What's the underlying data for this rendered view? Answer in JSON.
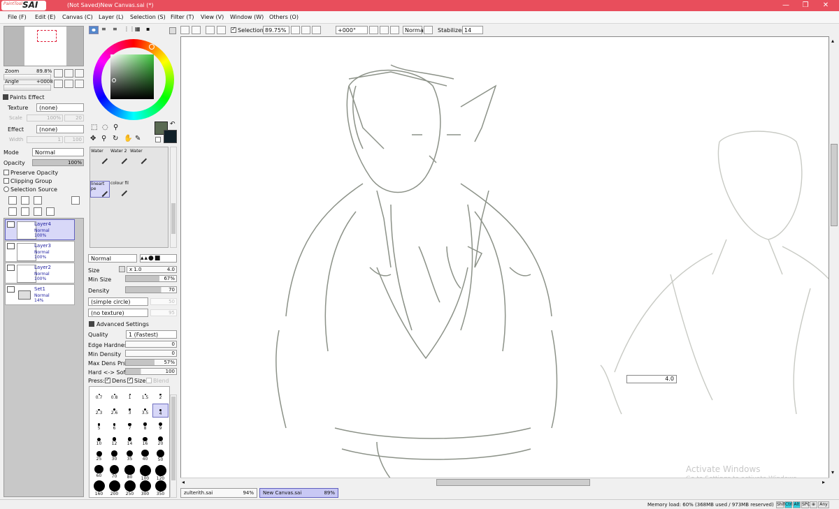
{
  "window": {
    "app_logo_small": "PaintTool",
    "app_logo_big": "SAI",
    "title": "(Not Saved)New Canvas.sai (*)",
    "minimize": "—",
    "restore": "❐",
    "close": "✕"
  },
  "menu": [
    "File (F)",
    "Edit (E)",
    "Canvas (C)",
    "Layer (L)",
    "Selection (S)",
    "Filter (T)",
    "View (V)",
    "Window (W)",
    "Others (O)"
  ],
  "toolbar": {
    "selection_label": "Selection",
    "zoom_value": "89.75%",
    "angle_value": "+000°",
    "blend_mode": "Normal",
    "stabilizer_label": "Stabilizer",
    "stabilizer_value": "14"
  },
  "navigator": {
    "zoom_label": "Zoom",
    "zoom_value": "89.8%",
    "angle_label": "Angle",
    "angle_value": "+0008"
  },
  "paints_effect": {
    "header": "Paints Effect",
    "texture_label": "Texture",
    "texture_value": "(none)",
    "scale_label": "Scale",
    "scale_value": "100%",
    "scale_num": "20",
    "effect_label": "Effect",
    "effect_value": "(none)",
    "width_label": "Width",
    "width_value": "1",
    "width_num": "100"
  },
  "layer_props": {
    "mode_label": "Mode",
    "mode_value": "Normal",
    "opacity_label": "Opacity",
    "opacity_value": "100%",
    "opacity_fraction": 1.0,
    "preserve_opacity": "Preserve Opacity",
    "clipping_group": "Clipping Group",
    "selection_source": "Selection Source"
  },
  "layers": [
    {
      "name": "Layer4",
      "mode": "Normal",
      "opacity": "100%",
      "selected": true
    },
    {
      "name": "Layer3",
      "mode": "Normal",
      "opacity": "100%",
      "selected": false
    },
    {
      "name": "Layer2",
      "mode": "Normal",
      "opacity": "100%",
      "selected": false
    },
    {
      "name": "Set1",
      "mode": "Normal",
      "opacity": "14%",
      "selected": false
    }
  ],
  "colors": {
    "primary": "#5a6a52",
    "secondary": "#102028",
    "accent_selected": "#d8d8f8",
    "title_bar": "#e84e5c"
  },
  "tools": [
    {
      "label": "Water",
      "selected": false
    },
    {
      "label": "Water 2",
      "selected": false
    },
    {
      "label": "Water",
      "selected": false
    },
    {
      "label": "lineart pe",
      "selected": true
    },
    {
      "label": "colour fil",
      "selected": false
    }
  ],
  "brush": {
    "blend_mode": "Normal",
    "size_label": "Size",
    "size_multiplier": "x 1.0",
    "size_value": "4.0",
    "min_size_label": "Min Size",
    "min_size_value": "67%",
    "min_size_fraction": 0.67,
    "density_label": "Density",
    "density_value": "70",
    "density_fraction": 0.7,
    "shape": "(simple circle)",
    "shape_num": "50",
    "texture": "(no texture)",
    "texture_num": "95",
    "advanced_header": "Advanced Settings",
    "quality_label": "Quality",
    "quality_value": "1 (Fastest)",
    "edge_hardness_label": "Edge Hardness",
    "edge_hardness_value": "0",
    "min_density_label": "Min Density",
    "min_density_value": "0",
    "max_dens_label": "Max Dens Prs.",
    "max_dens_value": "57%",
    "max_dens_fraction": 0.57,
    "hard_soft_label": "Hard <-> Soft",
    "hard_soft_value": "100",
    "hard_soft_fraction": 0.3,
    "press_label": "Press:",
    "dens_label": "Dens",
    "size_check_label": "Size",
    "blend_label": "Blend"
  },
  "brush_sizes": [
    "0.7",
    "0.8",
    "1",
    "1.5",
    "2",
    "2.3",
    "2.6",
    "3",
    "3.5",
    "4",
    "5",
    "6",
    "7",
    "8",
    "9",
    "10",
    "12",
    "14",
    "16",
    "20",
    "25",
    "30",
    "35",
    "40",
    "50",
    "60",
    "70",
    "80",
    "100",
    "120",
    "160",
    "200",
    "250",
    "300",
    "350"
  ],
  "brush_size_selected": "4",
  "canvas_popup_size": "4.0",
  "doc_tabs": [
    {
      "name": "zulterith.sai",
      "zoom": "94%",
      "active": false
    },
    {
      "name": "New Canvas.sai",
      "zoom": "89%",
      "active": true
    }
  ],
  "status": {
    "memory": "Memory load: 60% (368MB used / 973MB reserved)",
    "keys": [
      "Shift",
      "Ctrl",
      "Alt",
      "SPC",
      "⊕",
      "Any"
    ],
    "keys_on": [
      false,
      true,
      true,
      false,
      false,
      false
    ]
  },
  "watermark": {
    "line1": "Activate Windows",
    "line2": "Go to Settings to activate Windows."
  }
}
